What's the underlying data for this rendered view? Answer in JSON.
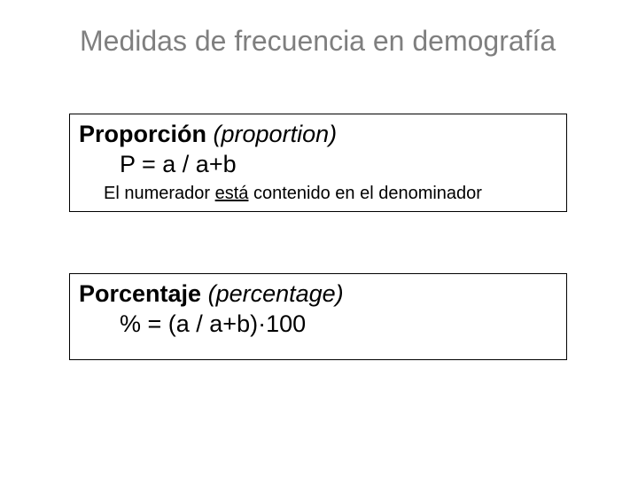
{
  "title": "Medidas de frecuencia en demografía",
  "box1": {
    "term": "Proporción",
    "translation": "(proportion)",
    "formula": "P = a / a+b",
    "note_pre": "El numerador ",
    "note_underline": "está",
    "note_post": " contenido en el denominador"
  },
  "box2": {
    "term": "Porcentaje",
    "translation": "(percentage)",
    "formula": "% = (a / a+b)·100"
  }
}
